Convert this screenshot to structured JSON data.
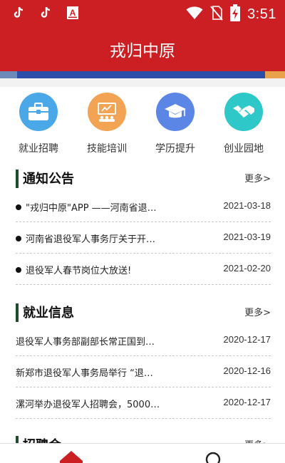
{
  "app": {
    "title": "戎归中原"
  },
  "status_bar": {
    "time": "3:51",
    "icons": [
      "tiktok-icon",
      "tiktok-icon",
      "a-notification-icon",
      "wifi-icon",
      "no-sim-icon",
      "battery-charging-icon"
    ]
  },
  "quick_nav": [
    {
      "label": "就业招聘",
      "icon": "briefcase-icon",
      "color": "#4aa7e8"
    },
    {
      "label": "技能培训",
      "icon": "training-board-icon",
      "color": "#f2a454"
    },
    {
      "label": "学历提升",
      "icon": "graduation-cap-icon",
      "color": "#5b86e5"
    },
    {
      "label": "创业园地",
      "icon": "handshake-icon",
      "color": "#2fc8c8"
    }
  ],
  "notices": {
    "title": "通知公告",
    "more": "更多>",
    "items": [
      {
        "title": "\"戎归中原\"APP ——河南省退…",
        "date": "2021-03-18"
      },
      {
        "title": "河南省退役军人事务厅关于开…",
        "date": "2021-03-19"
      },
      {
        "title": "退役军人春节岗位大放送!",
        "date": "2021-02-20"
      }
    ]
  },
  "jobs_info": {
    "title": "就业信息",
    "more": "更多>",
    "items": [
      {
        "title": "退役军人事务部副部长常正国到…",
        "date": "2020-12-17"
      },
      {
        "title": "新郑市退役军人事务局举行 “退…",
        "date": "2020-12-16"
      },
      {
        "title": "漯河举办退役军人招聘会，5000…",
        "date": "2020-12-17"
      }
    ]
  },
  "recruit": {
    "title": "招聘会",
    "more": "更多>"
  },
  "colors": {
    "brand": "#cc1f24",
    "section_bar": "#204b2e"
  },
  "bottom_nav": [
    "home-icon",
    "search-icon"
  ]
}
